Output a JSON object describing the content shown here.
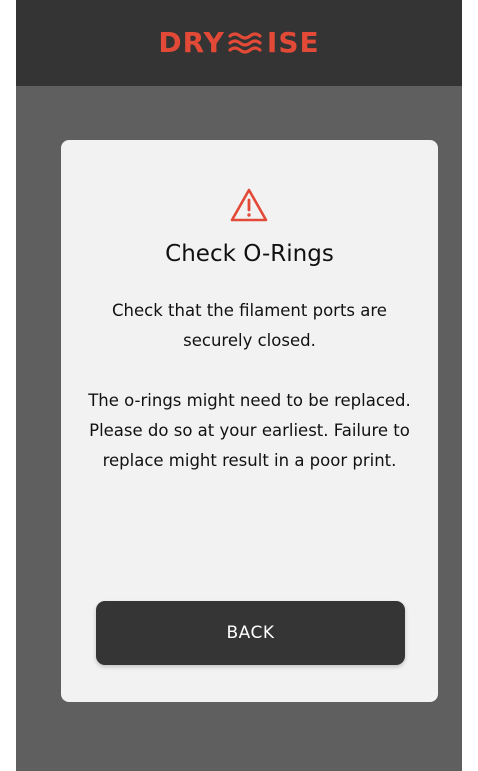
{
  "header": {
    "logo_left": "DRY",
    "logo_right": "ISE",
    "logo_mark": "triple-wave-logo-mark"
  },
  "dialog": {
    "icon": "warning-triangle-icon",
    "title": "Check O-Rings",
    "message_1": "Check that the filament ports are securely closed.",
    "message_2": "The o-rings might need to be replaced. Please do so at your earliest. Failure to replace might result in a poor print.",
    "back_label": "BACK"
  },
  "colors": {
    "accent": "#e24a37",
    "header_bg": "#343434",
    "screen_bg": "#5f5f5f",
    "card_bg": "#f2f2f2",
    "button_bg": "#353535"
  }
}
